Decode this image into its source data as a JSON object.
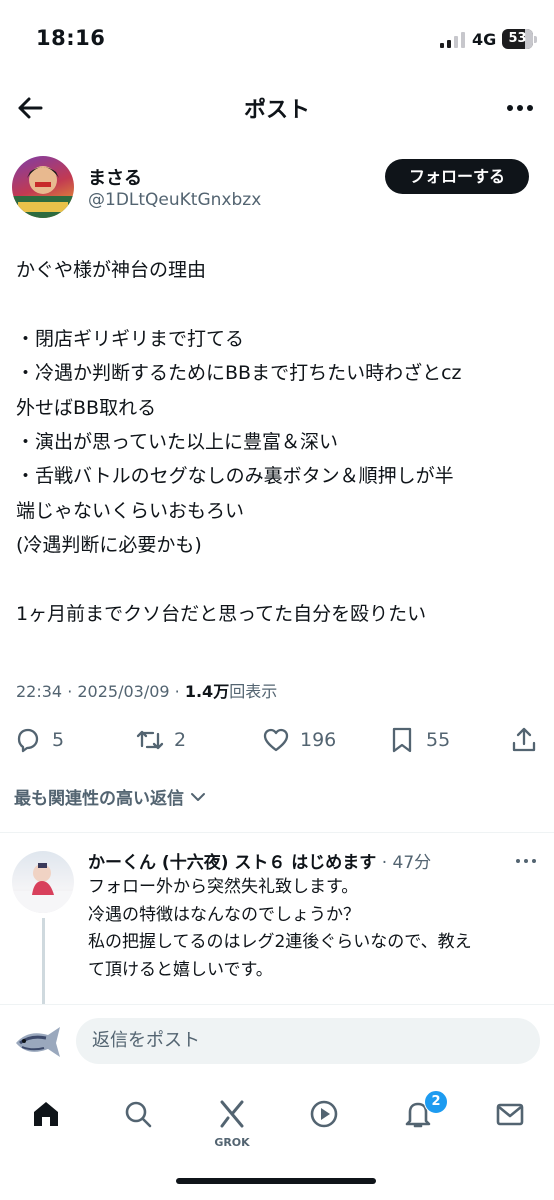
{
  "status_bar": {
    "time": "18:16",
    "network": "4G",
    "battery": "53"
  },
  "header": {
    "title": "ポスト",
    "back_icon": "back-arrow-icon",
    "more_icon": "more-horizontal-icon"
  },
  "post": {
    "author_name": "まさる",
    "author_handle": "@1DLtQeuKtGnxbzx",
    "follow_label": "フォローする",
    "lines": [
      "かぐや様が神台の理由",
      "",
      "・閉店ギリギリまで打てる",
      "・冷遇か判断するためにBBまで打ちたい時わざとcz",
      "外せばBB取れる",
      "・演出が思っていた以上に豊富＆深い",
      "・舌戦バトルのセグなしのみ裏ボタン＆順押しが半",
      "端じゃないくらいおもろい",
      "(冷遇判断に必要かも)",
      "",
      "1ヶ月前までクソ台だと思ってた自分を殴りたい"
    ],
    "timestamp": "22:34 · 2025/03/09 · ",
    "views_count": "1.4万",
    "views_label": "回表示"
  },
  "actions": {
    "replies": "5",
    "reposts": "2",
    "likes": "196",
    "bookmarks": "55"
  },
  "sort_label": "最も関連性の高い返信",
  "reply": {
    "name": "かーくん (十六夜) スト６ はじめます",
    "time": " · 47分",
    "lines": [
      "フォロー外から突然失礼致します。",
      "冷遇の特徴はなんなのでしょうか？",
      "私の把握してるのはレグ2連後ぐらいなので、教え",
      "て頂けると嬉しいです。"
    ]
  },
  "compose": {
    "placeholder": "返信をポスト"
  },
  "tab_bar": {
    "grok_label": "GROK",
    "notification_badge": "2"
  },
  "colors": {
    "text": "#0f1419",
    "secondary": "#536471",
    "accent": "#1d9bf0",
    "input_bg": "#eff3f4"
  }
}
